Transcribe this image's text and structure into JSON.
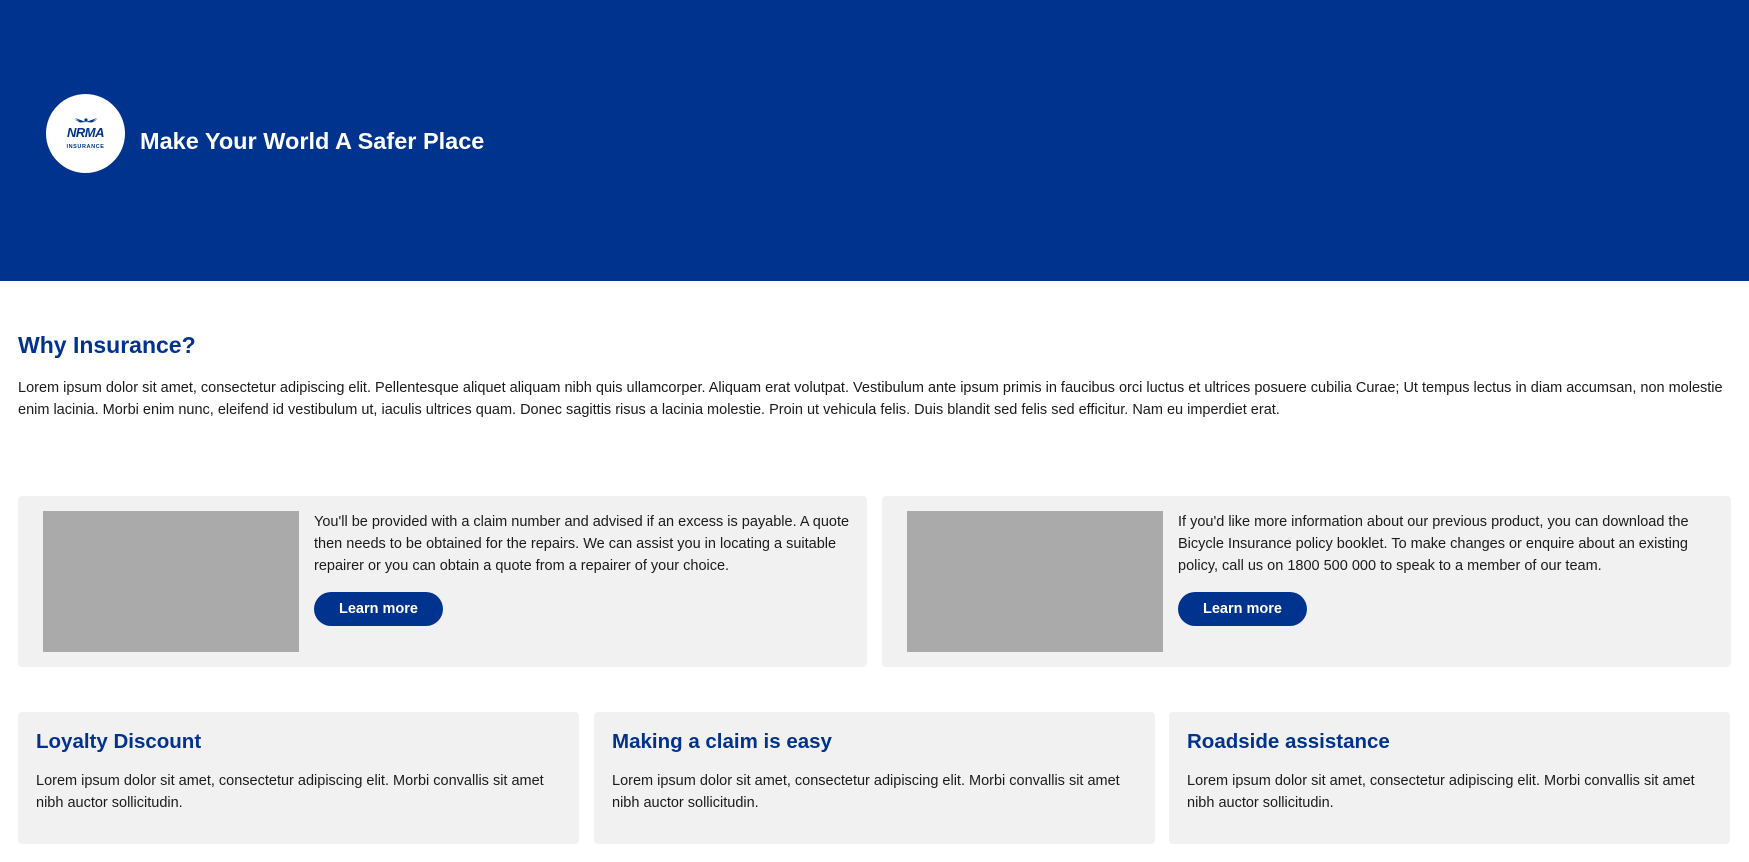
{
  "hero": {
    "logo": {
      "brand": "NRMA",
      "subtitle": "INSURANCE"
    },
    "title": "Make Your World A Safer Place",
    "background_color": "#00338d"
  },
  "intro": {
    "heading": "Why Insurance?",
    "body": "Lorem ipsum dolor sit amet, consectetur adipiscing elit. Pellentesque aliquet aliquam nibh quis ullamcorper. Aliquam erat volutpat. Vestibulum ante ipsum primis in faucibus orci luctus et ultrices posuere cubilia Curae; Ut tempus lectus in diam accumsan, non molestie enim lacinia. Morbi enim nunc, eleifend id vestibulum ut, iaculis ultrices quam. Donec sagittis risus a lacinia molestie. Proin ut vehicula felis. Duis blandit sed felis sed efficitur. Nam eu imperdiet erat."
  },
  "features": [
    {
      "text": "You'll be provided with a claim number and advised if an excess is payable. A quote then needs to be obtained for the repairs. We can assist you in locating a suitable repairer or you can obtain a quote from a repairer of your choice.",
      "button_label": "Learn more"
    },
    {
      "text": "If you'd like more information about our previous product, you can download the Bicycle Insurance policy booklet. To make changes or enquire about an existing policy, call us on 1800 500 000 to speak to a member of our team.",
      "button_label": "Learn more"
    }
  ],
  "info_cards": [
    {
      "title": "Loyalty Discount",
      "text": "Lorem ipsum dolor sit amet, consectetur adipiscing elit. Morbi convallis sit amet nibh auctor sollicitudin."
    },
    {
      "title": "Making a claim is easy",
      "text": "Lorem ipsum dolor sit amet, consectetur adipiscing elit. Morbi convallis sit amet nibh auctor sollicitudin."
    },
    {
      "title": "Roadside assistance",
      "text": "Lorem ipsum dolor sit amet, consectetur adipiscing elit. Morbi convallis sit amet nibh auctor sollicitudin."
    }
  ],
  "colors": {
    "brand_blue": "#00338d",
    "card_background": "#f1f1f1",
    "image_placeholder": "#aaaaaa"
  }
}
